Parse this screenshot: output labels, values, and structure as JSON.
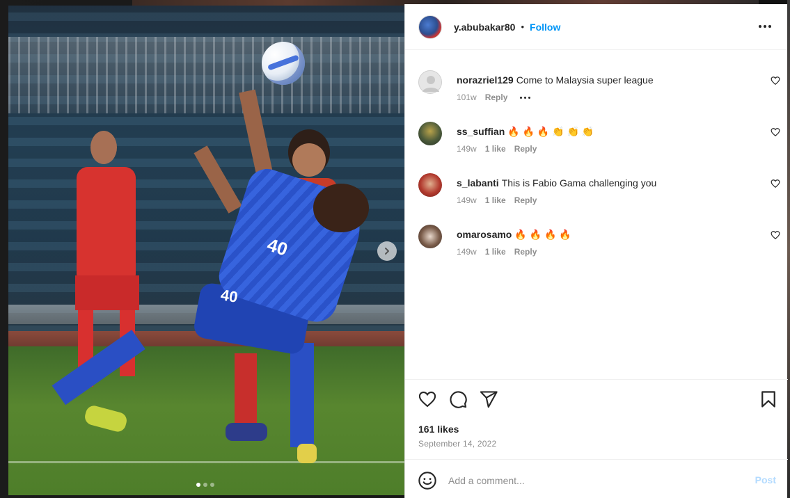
{
  "post": {
    "owner": "y.abubakar80",
    "separator": "•",
    "follow_label": "Follow",
    "more_icon": "more-horizontal-icon"
  },
  "comments": [
    {
      "user": "norazriel129",
      "text": "Come to Malaysia super league",
      "age": "101w",
      "likes": "",
      "reply": "Reply",
      "has_more": true,
      "avatar_color": "#e6e6e6"
    },
    {
      "user": "ss_suffian",
      "text": "🔥 🔥 🔥 👏 👏 👏",
      "age": "149w",
      "likes": "1 like",
      "reply": "Reply",
      "has_more": false,
      "avatar_color": "#4b5a3a"
    },
    {
      "user": "s_labanti",
      "text": "This is Fabio Gama challenging you",
      "age": "149w",
      "likes": "1 like",
      "reply": "Reply",
      "has_more": false,
      "avatar_color": "#b23a2e"
    },
    {
      "user": "omarosamo",
      "text": "🔥 🔥 🔥 🔥",
      "age": "149w",
      "likes": "1 like",
      "reply": "Reply",
      "has_more": false,
      "avatar_color": "#7a5c4a"
    }
  ],
  "actions": {
    "like_icon": "heart-icon",
    "comment_icon": "comment-bubble-icon",
    "share_icon": "send-icon",
    "save_icon": "bookmark-icon"
  },
  "stats": {
    "likes": "161 likes",
    "date": "September 14, 2022"
  },
  "composer": {
    "placeholder": "Add a comment...",
    "post_label": "Post",
    "emoji_icon": "emoji-smile-icon"
  },
  "photo": {
    "jersey_number": "40",
    "carousel_count": 3,
    "carousel_active": 1
  },
  "colors": {
    "link": "#0095f6",
    "post_disabled": "#b3dbff",
    "muted": "#8e8e8e",
    "text": "#262626"
  }
}
